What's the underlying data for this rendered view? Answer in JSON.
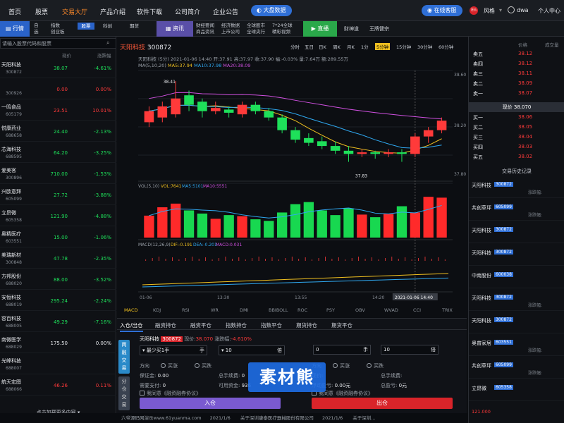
{
  "nav": {
    "items": [
      "首页",
      "股票",
      "交易大厅",
      "产品介绍",
      "软件下载",
      "公司简介",
      "企业公告"
    ],
    "active_index": 2,
    "bigdata": "大盘数据",
    "service": "在线客服",
    "en_badge": "En",
    "style": "风格",
    "user": "dwa",
    "center": "个人中心"
  },
  "subbar": {
    "quote_label": "行情",
    "mini_a": [
      "自",
      "选"
    ],
    "mini_b": [
      "股",
      "指数",
      "创业板"
    ],
    "tab_stock": "股票",
    "tab_period": "期货",
    "tab_option": "科创",
    "info_label": "资讯",
    "info_links": [
      "财经要闻",
      "经济数据",
      "全球股市",
      "7*24全球",
      "商品资讯",
      "上市公司",
      "全球央行",
      "精彩视频"
    ],
    "live_label": "直播",
    "live_links": [
      "财神道",
      "王牌健宗"
    ]
  },
  "left": {
    "search_placeholder": "请输入股票代码和股票",
    "col_price": "现价",
    "col_pct": "涨跌幅",
    "stocks": [
      {
        "name": "天阳科技",
        "tag": "",
        "code": "300872",
        "price": "38.07",
        "pct": "-4.61%",
        "dir": "dn"
      },
      {
        "name": "",
        "tag": "",
        "code": "300926",
        "price": "0.00",
        "pct": "0.00%",
        "dir": "up"
      },
      {
        "name": "一鸣食品",
        "tag": "",
        "code": "605179",
        "price": "23.51",
        "pct": "10.01%",
        "dir": "up"
      },
      {
        "name": "悦康药业",
        "tag": "",
        "code": "688658",
        "price": "24.40",
        "pct": "-2.13%",
        "dir": "dn"
      },
      {
        "name": "芯海科技",
        "tag": "",
        "code": "688595",
        "price": "64.20",
        "pct": "-3.25%",
        "dir": "dn"
      },
      {
        "name": "爱美客",
        "tag": "",
        "code": "300896",
        "price": "710.00",
        "pct": "-1.53%",
        "dir": "dn"
      },
      {
        "name": "兴欧意拜",
        "tag": "",
        "code": "605099",
        "price": "27.72",
        "pct": "-3.88%",
        "dir": "dn"
      },
      {
        "name": "立昂微",
        "tag": "",
        "code": "605358",
        "price": "121.90",
        "pct": "-4.88%",
        "dir": "dn"
      },
      {
        "name": "奥精医疗",
        "tag": "",
        "code": "603551",
        "price": "15.00",
        "pct": "-1.06%",
        "dir": "dn"
      },
      {
        "name": "美瑞新材",
        "tag": "",
        "code": "300848",
        "price": "47.78",
        "pct": "-2.35%",
        "dir": "dn"
      },
      {
        "name": "方邦股份",
        "tag": "",
        "code": "688020",
        "price": "88.00",
        "pct": "-3.52%",
        "dir": "dn"
      },
      {
        "name": "安恒科技",
        "tag": "",
        "code": "688019",
        "price": "295.24",
        "pct": "-2.24%",
        "dir": "dn"
      },
      {
        "name": "容百科技",
        "tag": "",
        "code": "688005",
        "price": "49.29",
        "pct": "-7.16%",
        "dir": "dn"
      },
      {
        "name": "南微医学",
        "tag": "",
        "code": "688029",
        "price": "175.50",
        "pct": "0.00%",
        "dir": "wh"
      },
      {
        "name": "光峰科技",
        "tag": "",
        "code": "688007",
        "price": "",
        "pct": "",
        "dir": "wh"
      },
      {
        "name": "航天宏图",
        "tag": "",
        "code": "688066",
        "price": "46.26",
        "pct": "0.11%",
        "dir": "up"
      }
    ],
    "load_more": "点击加载更多内容"
  },
  "chart": {
    "stock_name": "天阳科技",
    "stock_code": "300872",
    "periods": [
      "分时",
      "五日",
      "日K",
      "周K",
      "月K",
      "1分",
      "5分钟",
      "15分钟",
      "30分钟",
      "60分钟"
    ],
    "active_period": 6,
    "info_line": "天阳科技 (5分)  2021-01-06  14:40  开:37.91  高:37.97  收:37.90  幅:-0.03%  量:7.64万  额:289.55万",
    "ma_label": "MA(5,10,20)",
    "ma5": "MA5:37.94",
    "ma10": "MA10:37.98",
    "ma20": "MA20:38.09",
    "y_top": "38.60",
    "y_mid": "38.20",
    "y_bot": "37.80",
    "hi_note": "38.41",
    "lo_note": "37.83",
    "vol_label": "VOL(5,10)",
    "vol_val": "VOL:7641",
    "vol_ma5": "MA5:5101",
    "vol_ma10": "MA10:5551",
    "macd_label": "MACD(12,26,9)",
    "dif": "DIF:-0.191",
    "dea": "DEA:-0.201",
    "macd": "MACD:0.031",
    "x_ticks": [
      "01-06",
      "13:30",
      "13:55",
      "14:20"
    ],
    "cursor_time": "2021-01-06  14:40",
    "indicators": [
      "MACD",
      "KDJ",
      "RSI",
      "WR",
      "DMI",
      "BBIBOLL",
      "ROC",
      "PSY",
      "OBV",
      "WVAD",
      "CCI",
      "TRIX"
    ],
    "candles": [
      {
        "o": 38.15,
        "c": 38.22,
        "h": 38.25,
        "l": 38.12
      },
      {
        "o": 38.18,
        "c": 38.25,
        "h": 38.28,
        "l": 38.15
      },
      {
        "o": 38.2,
        "c": 38.3,
        "h": 38.41,
        "l": 38.18
      },
      {
        "o": 38.32,
        "c": 38.26,
        "h": 38.35,
        "l": 38.22
      },
      {
        "o": 38.28,
        "c": 38.22,
        "h": 38.3,
        "l": 38.18
      },
      {
        "o": 38.22,
        "c": 38.24,
        "h": 38.28,
        "l": 38.2
      },
      {
        "o": 38.23,
        "c": 38.21,
        "h": 38.25,
        "l": 38.18
      },
      {
        "o": 38.2,
        "c": 38.26,
        "h": 38.28,
        "l": 38.18
      },
      {
        "o": 38.26,
        "c": 38.22,
        "h": 38.28,
        "l": 38.2
      },
      {
        "o": 38.22,
        "c": 38.18,
        "h": 38.24,
        "l": 38.16
      },
      {
        "o": 38.18,
        "c": 38.1,
        "h": 38.2,
        "l": 38.08
      },
      {
        "o": 38.1,
        "c": 38.04,
        "h": 38.12,
        "l": 38.02
      },
      {
        "o": 38.05,
        "c": 38.02,
        "h": 38.08,
        "l": 38.0
      },
      {
        "o": 38.03,
        "c": 38.0,
        "h": 38.06,
        "l": 37.98
      },
      {
        "o": 38.0,
        "c": 37.97,
        "h": 38.03,
        "l": 37.95
      },
      {
        "o": 37.97,
        "c": 37.95,
        "h": 38.0,
        "l": 37.9
      },
      {
        "o": 37.95,
        "c": 37.96,
        "h": 37.98,
        "l": 37.93
      },
      {
        "o": 37.96,
        "c": 37.95,
        "h": 37.97,
        "l": 37.92
      },
      {
        "o": 37.95,
        "c": 37.96,
        "h": 37.98,
        "l": 37.93
      },
      {
        "o": 37.96,
        "c": 37.95,
        "h": 37.98,
        "l": 37.9
      },
      {
        "o": 37.95,
        "c": 38.06,
        "h": 38.08,
        "l": 37.93
      },
      {
        "o": 38.06,
        "c": 38.1,
        "h": 38.12,
        "l": 38.02
      },
      {
        "o": 38.1,
        "c": 38.16,
        "h": 38.18,
        "l": 38.08
      }
    ],
    "volumes": [
      4200,
      5800,
      6500,
      5200,
      4600,
      3600,
      4300,
      4100,
      3500,
      3200,
      4800,
      6400,
      6800,
      5200,
      4300,
      5600,
      4400,
      3900,
      4500,
      6000,
      4800,
      7800,
      7641
    ]
  },
  "trade": {
    "tabs": [
      "入仓/出仓",
      "融资持仓",
      "融资平仓",
      "指数持仓",
      "指数平仓",
      "期货持仓",
      "期货平仓"
    ],
    "side_buy": [
      "两",
      "融",
      "交",
      "易"
    ],
    "side_sell": [
      "分",
      "仓",
      "交",
      "易"
    ],
    "stock_name": "天阳科技",
    "stock_code": "300872",
    "price_label": "现价:",
    "price": "38.070",
    "change_label": "涨跌幅:",
    "change": "-4.610%",
    "order_type": "最少买1手",
    "order_unit": "手",
    "qty": "10",
    "qty_unit": "倍",
    "right_val": "0",
    "right_unit": "手",
    "right_qty": "10",
    "right_qty_unit": "倍",
    "dir_label": "方向",
    "opt_up": "买涨",
    "opt_down": "买跌",
    "margin_label": "保证金:",
    "margin_val": "0.00",
    "total_label": "总手续费:",
    "total_val": "0",
    "need_label": "需要支付:",
    "need_val": "0",
    "avail_label": "可用资金:",
    "avail_val": "936",
    "margin2": "保证金:",
    "fee2": "总手续费:",
    "float_label": "浮动盈亏:",
    "float_val": "0.00元",
    "total_pl_label": "总盈亏:",
    "total_pl_val": "0元",
    "agree": "我同意《融资融券协议》",
    "btn_buy": "入仓",
    "btn_sell": "出仓"
  },
  "orderbook": {
    "col_name": "",
    "col_price": "价格",
    "col_vol": "成交量",
    "asks": [
      {
        "label": "卖五",
        "price": "38.12"
      },
      {
        "label": "卖四",
        "price": "38.12"
      },
      {
        "label": "卖三",
        "price": "38.11"
      },
      {
        "label": "卖二",
        "price": "38.09"
      },
      {
        "label": "卖一",
        "price": "38.07"
      }
    ],
    "current": "现价 38.070",
    "bids": [
      {
        "label": "买一",
        "price": "38.06"
      },
      {
        "label": "买二",
        "price": "38.05"
      },
      {
        "label": "买三",
        "price": "38.04"
      },
      {
        "label": "买四",
        "price": "38.03"
      },
      {
        "label": "买五",
        "price": "38.02"
      }
    ],
    "history_title": "交易历史记录",
    "history": [
      {
        "name": "天阳科技",
        "code": "300872",
        "label": "涨跌幅:"
      },
      {
        "name": "共创草坪",
        "code": "605099",
        "label": "涨跌幅:"
      },
      {
        "name": "天阳科技",
        "code": "300872",
        "label": ""
      },
      {
        "name": "天阳科技",
        "code": "300872",
        "label": ""
      },
      {
        "name": "中南股份",
        "code": "600038",
        "label": ""
      },
      {
        "name": "天阳科技",
        "code": "300872",
        "label": "涨跌幅:"
      },
      {
        "name": "天阳科技",
        "code": "300872",
        "label": ""
      },
      {
        "name": "奥普家居",
        "code": "603551",
        "label": "涨跌幅:"
      },
      {
        "name": "共创草坪",
        "code": "605099",
        "label": "涨跌幅:"
      },
      {
        "name": "立昂微",
        "code": "605358",
        "label": ""
      }
    ],
    "hist_amount": "121.000"
  },
  "footer": {
    "t1": "六爷源码网演示www.61yuanma.com",
    "d1": "2021/1/6",
    "t2": "关于深圳康泰医疗器械股份有限公司",
    "d2": "2021/1/6",
    "t3": "关于深圳..."
  },
  "watermark": {
    "text": "素材熊"
  },
  "colors": {
    "up": "#ff3a3a",
    "down": "#1ee05a",
    "accent": "#2f6fd6",
    "active_nav": "#ff8a2a"
  }
}
